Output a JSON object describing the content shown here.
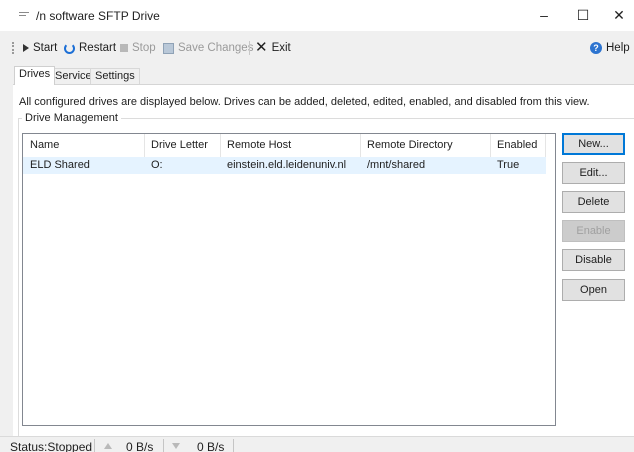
{
  "window": {
    "title": "/n software SFTP Drive",
    "minimize": "–",
    "maximize": "☐",
    "close": "✕"
  },
  "toolbar": {
    "start": "Start",
    "restart": "Restart",
    "stop": "Stop",
    "save_changes": "Save Changes",
    "exit": "Exit",
    "help": "Help",
    "help_icon_glyph": "?"
  },
  "tabs": [
    "Drives",
    "Service",
    "Settings"
  ],
  "description": "All configured drives are displayed below. Drives can be added, deleted, edited, enabled, and disabled from this view.",
  "group_title": "Drive Management",
  "table": {
    "columns": [
      "Name",
      "Drive Letter",
      "Remote Host",
      "Remote Directory",
      "Enabled"
    ],
    "rows": [
      [
        "ELD Shared",
        "O:",
        "einstein.eld.leidenuniv.nl",
        "/mnt/shared",
        "True"
      ]
    ]
  },
  "buttons": {
    "new": "New...",
    "edit": "Edit...",
    "delete": "Delete",
    "enable": "Enable",
    "disable": "Disable",
    "open": "Open"
  },
  "status": {
    "text": "Status:Stopped",
    "upload_rate": "0 B/s",
    "download_rate": "0 B/s"
  },
  "colors": {
    "selected_row": "#e5f3ff",
    "accent": "#0078d7",
    "restart_icon": "#1c6fd6"
  }
}
